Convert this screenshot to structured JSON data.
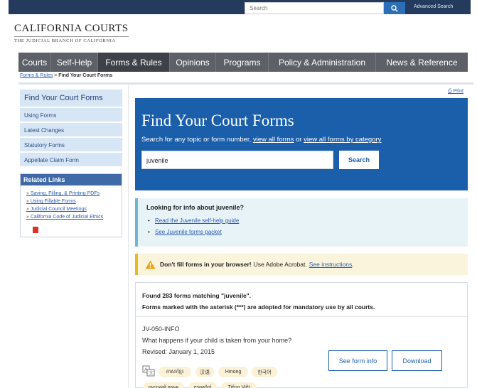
{
  "topbar": {
    "search_placeholder": "Search",
    "advanced_search": "Advanced Search",
    "search_icon": "search-icon"
  },
  "logo": {
    "name": "CALIFORNIA COURTS",
    "subtitle": "THE JUDICIAL BRANCH OF CALIFORNIA"
  },
  "nav": {
    "items": [
      "Courts",
      "Self-Help",
      "Forms & Rules",
      "Opinions",
      "Programs",
      "Policy & Administration",
      "News & Reference"
    ],
    "active": "Forms & Rules"
  },
  "breadcrumb": {
    "parent": "Forms & Rules",
    "separator": ">",
    "current": "Find Your Court Forms"
  },
  "sidebar": {
    "heading": "Find Your Court Forms",
    "links": [
      "Using Forms",
      "Latest Changes",
      "Statutory Forms",
      "Appellate Claim Form"
    ],
    "related_heading": "Related Links",
    "related_links": [
      "Saving, Filling, & Printing PDFs",
      "Using Fillable Forms",
      "Judicial Council Meetings",
      "California Code of Judicial Ethics"
    ]
  },
  "print": "Print",
  "hero": {
    "title": "Find Your Court Forms",
    "desc_prefix": "Search for any topic or form number,",
    "link_all": "view all forms",
    "desc_mid": "or",
    "link_category": "view all forms by category",
    "search_value": "juvenile",
    "search_button": "Search"
  },
  "info": {
    "heading": "Looking for info about juvenile?",
    "links": [
      "Read the Juvenile self-help guide",
      "See Juvenile forms packet"
    ]
  },
  "warning": {
    "bold": "Don't fill forms in your browser!",
    "text": "Use Adobe Acrobat.",
    "link": "See instructions",
    "end": "."
  },
  "results": {
    "summary": "Found 283 forms matching \"juvenile\".",
    "note": "Forms marked with the asterisk (***) are adopted for mandatory use by all courts.",
    "form": {
      "code": "JV-050-INFO",
      "question": "What happens if your child is taken from your home?",
      "revised": "Revised: January 1, 2015",
      "see_info": "See form info",
      "download": "Download",
      "languages": [
        "ភាសាខ្មែរ",
        "汉语",
        "Hmong",
        "한국어",
        "русский язык",
        "español",
        "Tiếng Việt"
      ]
    }
  },
  "colors": {
    "hero_blue": "#1b5fab",
    "nav_gray": "#5d6067",
    "nav_active": "#3e4148",
    "warning_yellow": "#e8b923",
    "info_border": "#6fb5d6"
  }
}
